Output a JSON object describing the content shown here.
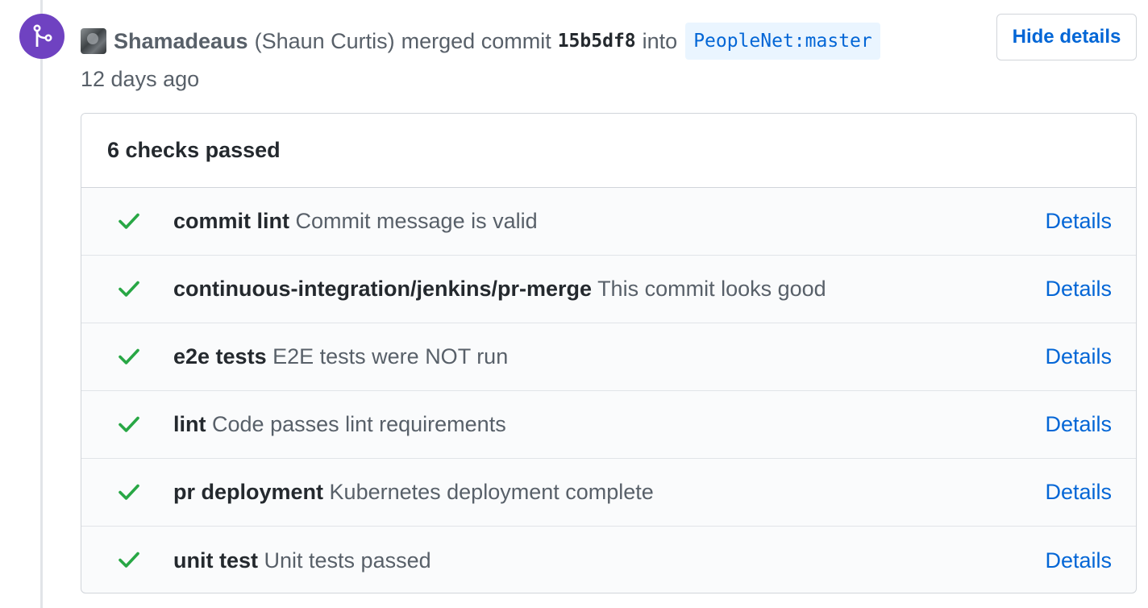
{
  "event": {
    "author_login": "Shamadeaus",
    "author_name": "(Shaun Curtis)",
    "action": "merged commit",
    "commit_sha": "15b5df8",
    "into_word": "into",
    "branch": "PeopleNet:master",
    "time_ago": "12 days ago",
    "badge_icon": "git-merge-icon",
    "badge_color": "#6f42c1",
    "hide_details_label": "Hide details"
  },
  "checks": {
    "summary": "6 checks passed",
    "status_color": "#28a745",
    "link_color": "#0366d6",
    "items": [
      {
        "name": "commit lint",
        "description": "Commit message is valid",
        "status": "success",
        "link_label": "Details"
      },
      {
        "name": "continuous-integration/jenkins/pr-merge",
        "description": "This commit looks good",
        "status": "success",
        "link_label": "Details"
      },
      {
        "name": "e2e tests",
        "description": "E2E tests were NOT run",
        "status": "success",
        "link_label": "Details"
      },
      {
        "name": "lint",
        "description": "Code passes lint requirements",
        "status": "success",
        "link_label": "Details"
      },
      {
        "name": "pr deployment",
        "description": "Kubernetes deployment complete",
        "status": "success",
        "link_label": "Details"
      },
      {
        "name": "unit test",
        "description": "Unit tests passed",
        "status": "success",
        "link_label": "Details"
      }
    ]
  }
}
